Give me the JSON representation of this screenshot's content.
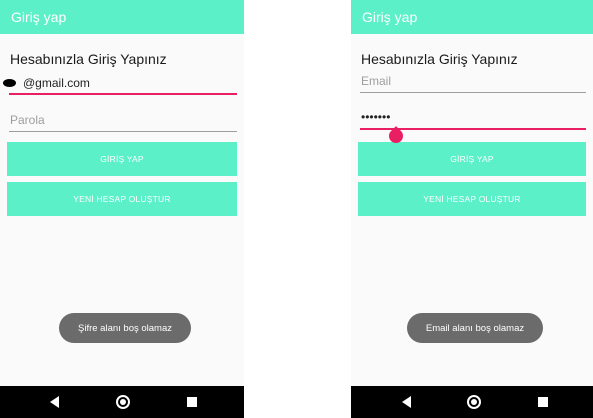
{
  "left": {
    "title": "Giriş yap",
    "heading": "Hesabınızla Giriş Yapınız",
    "email_value": "@gmail.com",
    "password_placeholder": "Parola",
    "login_label": "GİRİŞ YAP",
    "register_label": "YENİ HESAP OLUŞTUR",
    "toast": "Şifre alanı boş olamaz"
  },
  "right": {
    "title": "Giriş yap",
    "heading": "Hesabınızla Giriş Yapınız",
    "email_placeholder": "Email",
    "password_value": "•••••••",
    "login_label": "GİRİŞ YAP",
    "register_label": "YENİ HESAP OLUŞTUR",
    "toast": "Email alanı boş olamaz"
  },
  "colors": {
    "accent": "#5cf0c8",
    "field_active": "#e91e63",
    "toast_bg": "#6b6b6b"
  },
  "icons": [
    "back-icon",
    "home-icon",
    "recent-apps-icon"
  ]
}
